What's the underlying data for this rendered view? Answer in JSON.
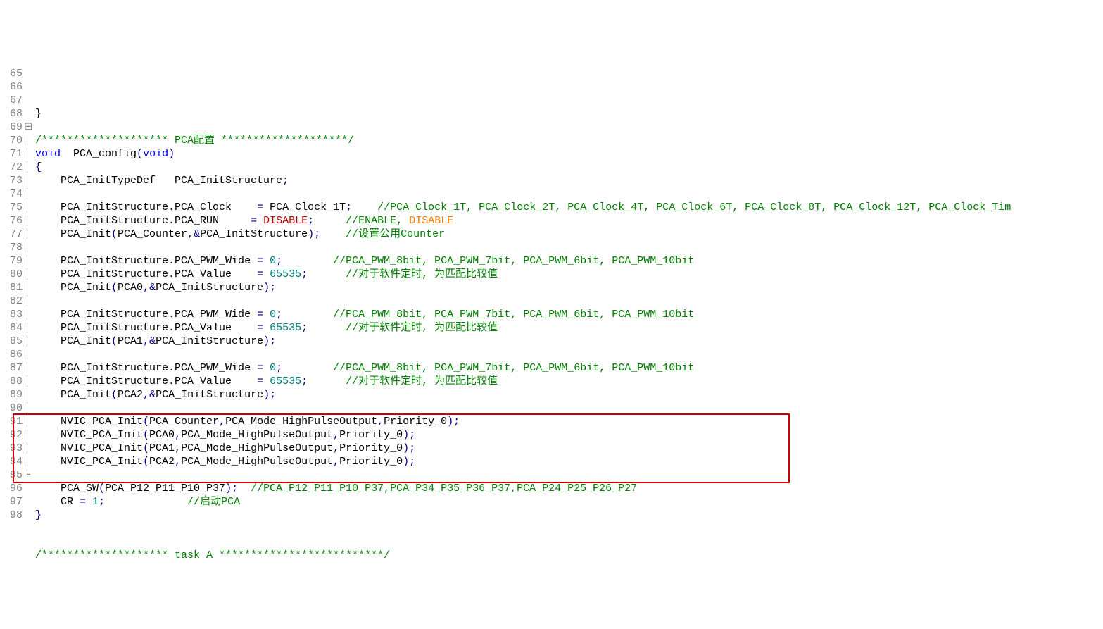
{
  "lines": [
    {
      "n": "65",
      "fold": "",
      "text": "}",
      "cls": ""
    },
    {
      "n": "66",
      "fold": "",
      "text": "",
      "cls": ""
    },
    {
      "n": "67",
      "fold": "",
      "html": "<span class='c-cm'>/******************** PCA配置 ********************/</span>"
    },
    {
      "n": "68",
      "fold": "",
      "html": "<span class='c-kw'>void</span>  PCA_config<span class='c-op'>(</span><span class='c-kw'>void</span><span class='c-op'>)</span>"
    },
    {
      "n": "69",
      "fold": "⊟",
      "html": "<span class='c-op'>{</span>"
    },
    {
      "n": "70",
      "fold": "│",
      "html": "    PCA_InitTypeDef   PCA_InitStructure<span class='c-op'>;</span>"
    },
    {
      "n": "71",
      "fold": "│",
      "text": ""
    },
    {
      "n": "72",
      "fold": "│",
      "html": "    PCA_InitStructure<span class='c-op'>.</span>PCA_Clock    <span class='c-op'>=</span> PCA_Clock_1T<span class='c-op'>;</span>    <span class='c-cm'>//PCA_Clock_1T, PCA_Clock_2T, PCA_Clock_4T, PCA_Clock_6T, PCA_Clock_8T, PCA_Clock_12T, PCA_Clock_Tim</span>"
    },
    {
      "n": "73",
      "fold": "│",
      "html": "    PCA_InitStructure<span class='c-op'>.</span>PCA_RUN     <span class='c-op'>=</span> <span class='c-dis2'>DISABLE</span><span class='c-op'>;</span>     <span class='c-cm'>//</span><span class='c-cm'>ENABLE, </span><span class='c-dis'>DISABLE</span>"
    },
    {
      "n": "74",
      "fold": "│",
      "html": "    PCA_Init<span class='c-op'>(</span>PCA_Counter<span class='c-op'>,&amp;</span>PCA_InitStructure<span class='c-op'>);</span>    <span class='c-cm'>//设置公用Counter</span>"
    },
    {
      "n": "75",
      "fold": "│",
      "text": ""
    },
    {
      "n": "76",
      "fold": "│",
      "html": "    PCA_InitStructure<span class='c-op'>.</span>PCA_PWM_Wide <span class='c-op'>=</span> <span class='c-num'>0</span><span class='c-op'>;</span>        <span class='c-cm'>//PCA_PWM_8bit, PCA_PWM_7bit, PCA_PWM_6bit, PCA_PWM_10bit</span>"
    },
    {
      "n": "77",
      "fold": "│",
      "html": "    PCA_InitStructure<span class='c-op'>.</span>PCA_Value    <span class='c-op'>=</span> <span class='c-num'>65535</span><span class='c-op'>;</span>      <span class='c-cm'>//对于软件定时, 为匹配比较值</span>"
    },
    {
      "n": "78",
      "fold": "│",
      "html": "    PCA_Init<span class='c-op'>(</span>PCA0<span class='c-op'>,&amp;</span>PCA_InitStructure<span class='c-op'>);</span>"
    },
    {
      "n": "79",
      "fold": "│",
      "text": ""
    },
    {
      "n": "80",
      "fold": "│",
      "html": "    PCA_InitStructure<span class='c-op'>.</span>PCA_PWM_Wide <span class='c-op'>=</span> <span class='c-num'>0</span><span class='c-op'>;</span>        <span class='c-cm'>//PCA_PWM_8bit, PCA_PWM_7bit, PCA_PWM_6bit, PCA_PWM_10bit</span>"
    },
    {
      "n": "81",
      "fold": "│",
      "html": "    PCA_InitStructure<span class='c-op'>.</span>PCA_Value    <span class='c-op'>=</span> <span class='c-num'>65535</span><span class='c-op'>;</span>      <span class='c-cm'>//对于软件定时, 为匹配比较值</span>"
    },
    {
      "n": "82",
      "fold": "│",
      "html": "    PCA_Init<span class='c-op'>(</span>PCA1<span class='c-op'>,&amp;</span>PCA_InitStructure<span class='c-op'>);</span>"
    },
    {
      "n": "83",
      "fold": "│",
      "text": ""
    },
    {
      "n": "84",
      "fold": "│",
      "html": "    PCA_InitStructure<span class='c-op'>.</span>PCA_PWM_Wide <span class='c-op'>=</span> <span class='c-num'>0</span><span class='c-op'>;</span>        <span class='c-cm'>//PCA_PWM_8bit, PCA_PWM_7bit, PCA_PWM_6bit, PCA_PWM_10bit</span>"
    },
    {
      "n": "85",
      "fold": "│",
      "html": "    PCA_InitStructure<span class='c-op'>.</span>PCA_Value    <span class='c-op'>=</span> <span class='c-num'>65535</span><span class='c-op'>;</span>      <span class='c-cm'>//对于软件定时, 为匹配比较值</span>"
    },
    {
      "n": "86",
      "fold": "│",
      "html": "    PCA_Init<span class='c-op'>(</span>PCA2<span class='c-op'>,&amp;</span>PCA_InitStructure<span class='c-op'>);</span>"
    },
    {
      "n": "87",
      "fold": "│",
      "text": ""
    },
    {
      "n": "88",
      "fold": "│",
      "html": "    NVIC_PCA_Init<span class='c-op'>(</span>PCA_Counter<span class='c-op'>,</span>PCA_Mode_HighPulseOutput<span class='c-op'>,</span>Priority_0<span class='c-op'>);</span>"
    },
    {
      "n": "89",
      "fold": "│",
      "html": "    NVIC_PCA_Init<span class='c-op'>(</span>PCA0<span class='c-op'>,</span>PCA_Mode_HighPulseOutput<span class='c-op'>,</span>Priority_0<span class='c-op'>);</span>"
    },
    {
      "n": "90",
      "fold": "│",
      "html": "    NVIC_PCA_Init<span class='c-op'>(</span>PCA1<span class='c-op'>,</span>PCA_Mode_HighPulseOutput<span class='c-op'>,</span>Priority_0<span class='c-op'>);</span>"
    },
    {
      "n": "91",
      "fold": "│",
      "html": "    NVIC_PCA_Init<span class='c-op'>(</span>PCA2<span class='c-op'>,</span>PCA_Mode_HighPulseOutput<span class='c-op'>,</span>Priority_0<span class='c-op'>);</span>"
    },
    {
      "n": "92",
      "fold": "│",
      "text": ""
    },
    {
      "n": "93",
      "fold": "│",
      "html": "    PCA_SW<span class='c-op'>(</span>PCA_P12_P11_P10_P37<span class='c-op'>);</span>  <span class='c-cm'>//PCA_P12_P11_P10_P37,PCA_P34_P35_P36_P37,PCA_P24_P25_P26_P27</span>"
    },
    {
      "n": "94",
      "fold": "│",
      "html": "    CR <span class='c-op'>=</span> <span class='c-num'>1</span><span class='c-op'>;</span>             <span class='c-cm'>//启动PCA</span>"
    },
    {
      "n": "95",
      "fold": "└",
      "html": "<span class='c-op'>}</span>"
    },
    {
      "n": "96",
      "fold": "",
      "text": ""
    },
    {
      "n": "97",
      "fold": "",
      "text": ""
    },
    {
      "n": "98",
      "fold": "",
      "html": "<span class='c-cm'>/******************** task A **************************/</span>"
    }
  ],
  "highlight": {
    "top_line_idx": 26,
    "height_lines": 5
  }
}
